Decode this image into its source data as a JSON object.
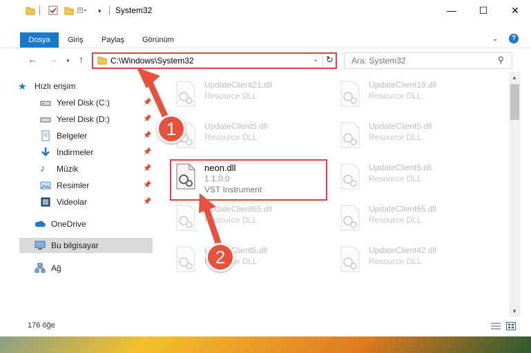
{
  "window": {
    "title": "System32",
    "min_glyph": "—",
    "max_glyph": "☐",
    "close_glyph": "✕"
  },
  "ribbon": {
    "tabs": [
      "Dosya",
      "Giriş",
      "Paylaş",
      "Görünüm"
    ],
    "help": "?"
  },
  "nav": {
    "address": "C:\\Windows\\System32",
    "search_placeholder": "Ara: System32"
  },
  "sidebar": {
    "items": [
      {
        "label": "Hızlı erişim",
        "icon": "star-icon"
      },
      {
        "label": "Yerel Disk (C:)",
        "icon": "drive-icon"
      },
      {
        "label": "Yerel Disk (D:)",
        "icon": "drive-icon"
      },
      {
        "label": "Belgeler",
        "icon": "documents-icon"
      },
      {
        "label": "İndirmeler",
        "icon": "download-icon"
      },
      {
        "label": "Müzik",
        "icon": "music-icon"
      },
      {
        "label": "Resimler",
        "icon": "pictures-icon"
      },
      {
        "label": "Videolar",
        "icon": "videos-icon"
      },
      {
        "label": "OneDrive",
        "icon": "cloud-icon"
      },
      {
        "label": "Bu bilgisayar",
        "icon": "computer-icon"
      },
      {
        "label": "Ağ",
        "icon": "network-icon"
      }
    ]
  },
  "files": [
    {
      "name": "UpdateClient21.dll",
      "desc": "Resource DLL"
    },
    {
      "name": "UpdateClient19.dll",
      "desc": "Resource DLL"
    },
    {
      "name": "UpdateClient5.dll",
      "desc": "Resource DLL"
    },
    {
      "name": "UpdateClient5.dll",
      "desc": "Resource DLL"
    },
    {
      "name": "neon.dll",
      "version": "1.1.0.0",
      "desc": "VST Instrument"
    },
    {
      "name": "UpdateClient5.dll",
      "desc": "Resource DLL"
    },
    {
      "name": "UpdateClient65.dll",
      "desc": "Resource DLL"
    },
    {
      "name": "UpdateClient65.dll",
      "desc": "Resource DLL"
    },
    {
      "name": "UpdateClient5.dll",
      "desc": "Resource DLL"
    },
    {
      "name": "UpdateClient42.dll",
      "desc": "Resource DLL"
    }
  ],
  "status": {
    "count": "176 öğe"
  },
  "annotations": {
    "badge1": "1",
    "badge2": "2",
    "color": "#e9513f"
  }
}
